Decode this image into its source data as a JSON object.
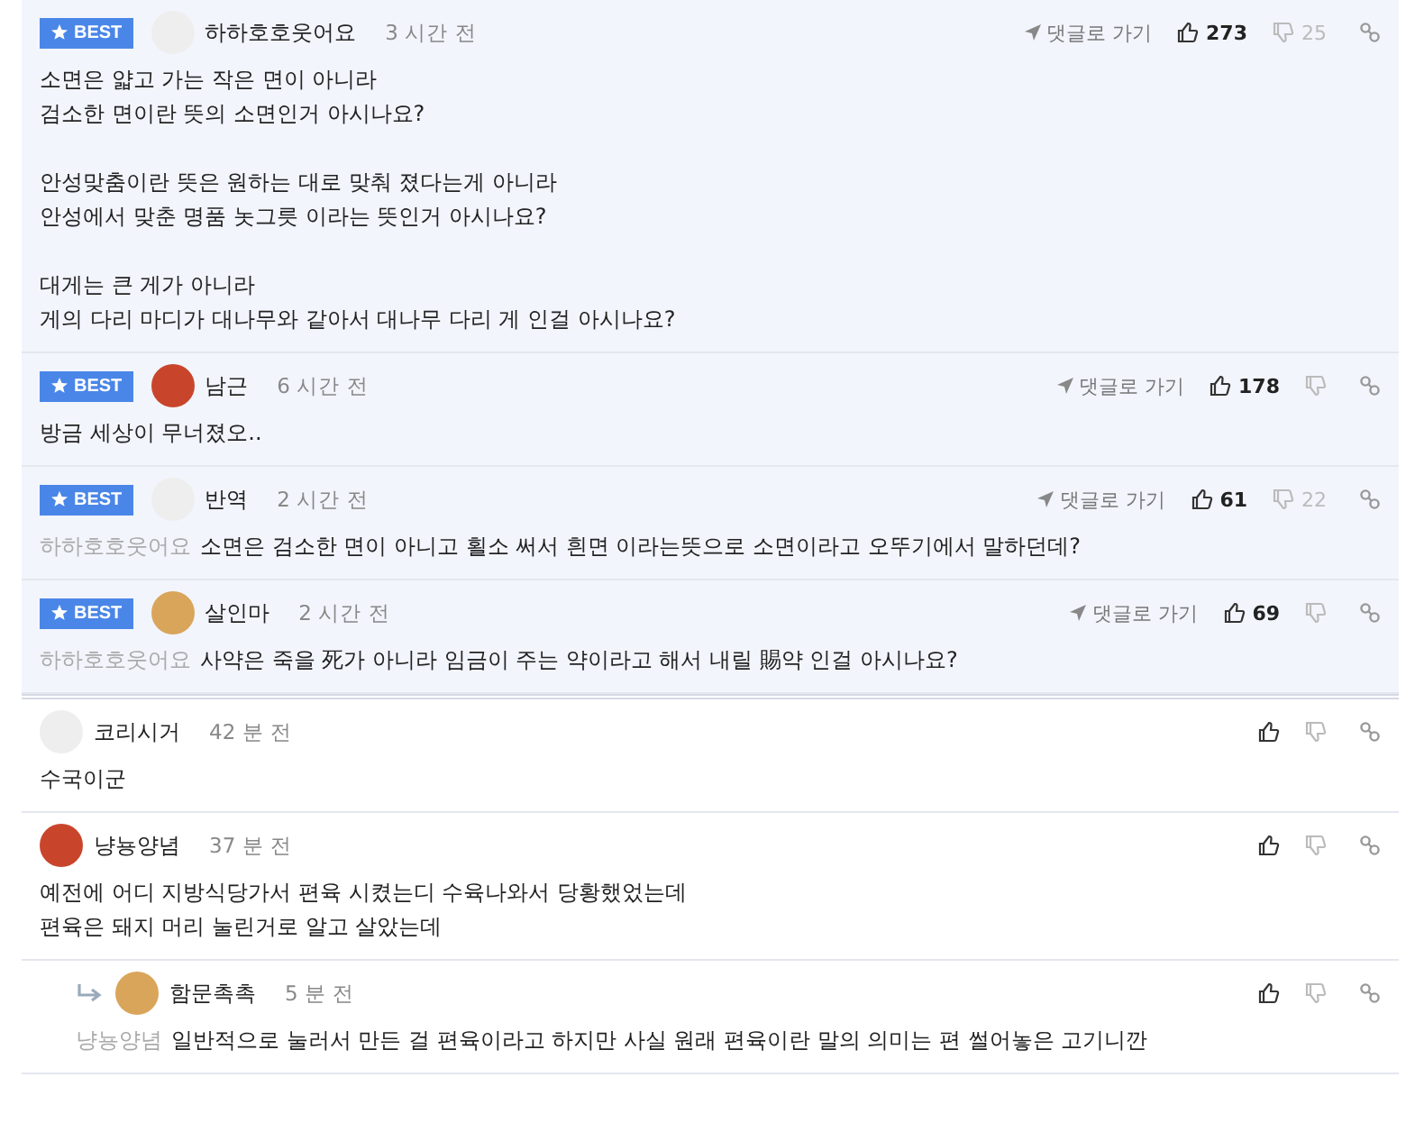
{
  "comments": [
    {
      "kind": "comment",
      "best": true,
      "badge": "BEST",
      "color": "#eeeeee",
      "author": "하하호호웃어요",
      "time": "3 시간 전",
      "goto": "댓글로 가기",
      "likes": "273",
      "dislikes": "25",
      "body": "소면은 얇고 가는 작은 면이 아니라\n검소한 면이란 뜻의 소면인거 아시나요?\n\n안성맞춤이란 뜻은 원하는 대로 맞춰 졌다는게 아니라\n안성에서 맞춘 명품 놋그릇 이라는 뜻인거 아시나요?\n\n대게는 큰 게가 아니라\n게의 다리 마디가 대나무와 같아서 대나무 다리 게 인걸 아시나요?"
    },
    {
      "kind": "comment",
      "best": true,
      "badge": "BEST",
      "color": "#c8452c",
      "author": "남근",
      "time": "6 시간 전",
      "goto": "댓글로 가기",
      "likes": "178",
      "body": "방금 세상이 무너졌오.."
    },
    {
      "kind": "comment",
      "best": true,
      "badge": "BEST",
      "color": "#eeeeee",
      "author": "반역",
      "time": "2 시간 전",
      "goto": "댓글로 가기",
      "likes": "61",
      "dislikes": "22",
      "mention": "하하호호웃어요",
      "body": "소면은 검소한 면이 아니고 횔소 써서 흰면 이라는뜻으로 소면이라고 오뚜기에서 말하던데?"
    },
    {
      "kind": "comment",
      "best": true,
      "badge": "BEST",
      "color": "#d9a55a",
      "author": "살인마",
      "time": "2 시간 전",
      "goto": "댓글로 가기",
      "likes": "69",
      "mention": "하하호호웃어요",
      "body": "사약은 죽을 死가 아니라 임금이 주는 약이라고 해서 내릴 賜약 인걸 아시나요?"
    },
    {
      "kind": "comment",
      "best": false,
      "color": "#eeeeee",
      "author": "코리시거",
      "time": "42 분 전",
      "body": "수국이군"
    },
    {
      "kind": "comment",
      "best": false,
      "color": "#c8452c",
      "author": "냥뇽양념",
      "time": "37 분 전",
      "body": "예전에 어디 지방식당가서 편육 시켰는디 수육나와서 당황했었는데\n편육은 돼지 머리 눌린거로 알고 살았는데"
    },
    {
      "kind": "reply",
      "best": false,
      "color": "#d9a55a",
      "author": "함문촉촉",
      "time": "5 분 전",
      "mention": "냥뇽양념",
      "body": "일반적으로 눌러서 만든 걸 편육이라고 하지만 사실 원래 편육이란 말의 의미는 편 썰어놓은 고기니깐"
    }
  ]
}
